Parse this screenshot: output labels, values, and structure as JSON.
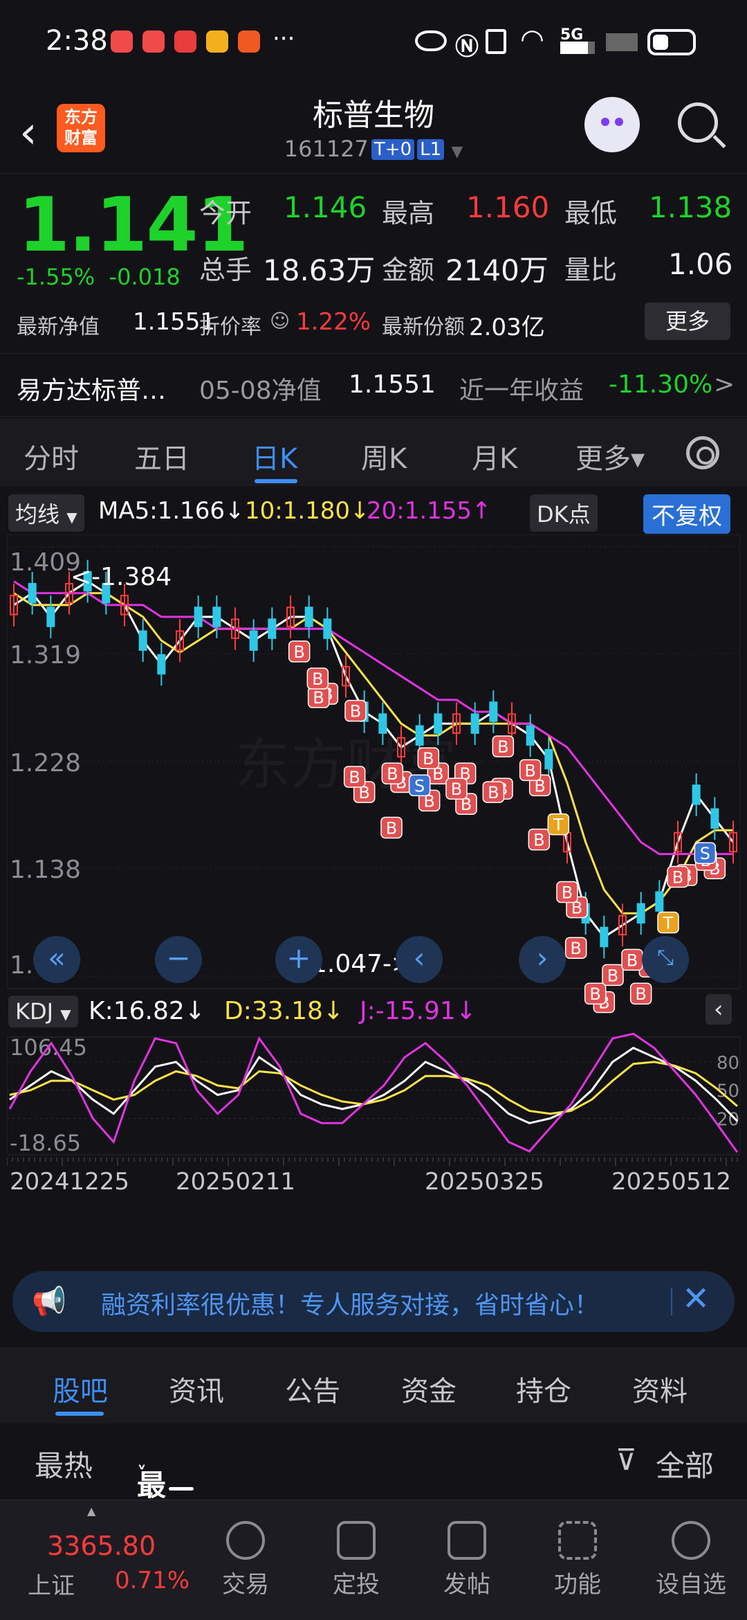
{
  "status_bar": {
    "time": "2:38",
    "more": "···",
    "network": "5G"
  },
  "header": {
    "title": "标普生物",
    "code": "161127",
    "tag1": "T+0",
    "tag2": "L1",
    "logo_line1": "东方",
    "logo_line2": "财富"
  },
  "quote": {
    "price": "1.141",
    "change_pct": "-1.55%",
    "change_abs": "-0.018",
    "open_label": "今开",
    "open": "1.146",
    "high_label": "最高",
    "high": "1.160",
    "low_label": "最低",
    "low": "1.138",
    "volume_label": "总手",
    "volume": "18.63万",
    "amount_label": "金额",
    "amount": "2140万",
    "ratio_label": "量比",
    "ratio": "1.06",
    "nav_label": "最新净值",
    "nav": "1.1551",
    "discount_label": "折价率",
    "discount": "1.22%",
    "shares_label": "最新份额",
    "shares": "2.03亿",
    "more_button": "更多"
  },
  "fund_row": {
    "name": "易方达标普…",
    "nav_date_label": "05-08净值",
    "nav_value": "1.1551",
    "year_return_label": "近一年收益",
    "year_return": "-11.30%",
    "arrow": ">"
  },
  "period_tabs": [
    "分时",
    "五日",
    "日K",
    "周K",
    "月K",
    "更多▾"
  ],
  "chart_header": {
    "indicator": "均线",
    "ma5": "MA5:1.166↓",
    "ma10": "10:1.180↓",
    "ma20": "20:1.155↑",
    "dk_button": "DK点",
    "adjust_button": "不复权"
  },
  "kdj_header": {
    "indicator": "KDJ",
    "k": "K:16.82↓",
    "d": "D:33.18↓",
    "j": "J:-15.91↓"
  },
  "chart_data": [
    {
      "type": "line",
      "title": "",
      "y_ticks": [
        "1.409",
        "1.319",
        "1.228",
        "1.138",
        "1.047"
      ],
      "ylim": [
        1.047,
        1.409
      ],
      "annotations": [
        "<-1.384",
        "1.047->"
      ],
      "series": [
        {
          "name": "MA5",
          "color": "#ffffff",
          "values": [
            1.36,
            1.37,
            1.35,
            1.37,
            1.38,
            1.37,
            1.36,
            1.33,
            1.31,
            1.33,
            1.35,
            1.35,
            1.34,
            1.33,
            1.34,
            1.35,
            1.35,
            1.34,
            1.3,
            1.27,
            1.26,
            1.24,
            1.25,
            1.26,
            1.26,
            1.26,
            1.27,
            1.26,
            1.25,
            1.23,
            1.16,
            1.1,
            1.08,
            1.09,
            1.1,
            1.11,
            1.16,
            1.2,
            1.18,
            1.16
          ]
        },
        {
          "name": "10",
          "color": "#ffe24a",
          "values": [
            1.37,
            1.36,
            1.36,
            1.36,
            1.37,
            1.37,
            1.36,
            1.35,
            1.33,
            1.32,
            1.33,
            1.34,
            1.34,
            1.34,
            1.34,
            1.34,
            1.35,
            1.34,
            1.32,
            1.3,
            1.28,
            1.26,
            1.25,
            1.25,
            1.26,
            1.26,
            1.26,
            1.26,
            1.26,
            1.25,
            1.21,
            1.16,
            1.12,
            1.1,
            1.1,
            1.11,
            1.13,
            1.16,
            1.17,
            1.17
          ]
        },
        {
          "name": "20",
          "color": "#e233e2",
          "values": [
            1.38,
            1.37,
            1.37,
            1.37,
            1.37,
            1.36,
            1.36,
            1.36,
            1.35,
            1.35,
            1.35,
            1.34,
            1.34,
            1.34,
            1.34,
            1.34,
            1.34,
            1.34,
            1.33,
            1.32,
            1.31,
            1.3,
            1.29,
            1.28,
            1.28,
            1.27,
            1.27,
            1.26,
            1.26,
            1.25,
            1.24,
            1.22,
            1.2,
            1.18,
            1.16,
            1.15,
            1.15,
            1.15,
            1.15,
            1.15
          ]
        }
      ],
      "markers_B": 36,
      "markers_S": 2,
      "markers_T": 2
    },
    {
      "type": "line",
      "title": "",
      "y_ticks": [
        "106.45",
        "-18.65"
      ],
      "right_ticks": [
        "80",
        "50",
        "20"
      ],
      "x_ticks": [
        "20241225",
        "20250211",
        "20250325",
        "20250512"
      ],
      "ylim": [
        -18.65,
        106.45
      ],
      "series": [
        {
          "name": "K",
          "color": "#ffffff",
          "values": [
            40,
            55,
            70,
            60,
            40,
            25,
            50,
            75,
            80,
            60,
            45,
            50,
            85,
            70,
            45,
            35,
            30,
            35,
            45,
            60,
            80,
            70,
            60,
            45,
            25,
            15,
            20,
            30,
            50,
            80,
            95,
            85,
            75,
            60,
            40,
            17
          ]
        },
        {
          "name": "D",
          "color": "#ffe24a",
          "values": [
            45,
            50,
            60,
            60,
            50,
            40,
            45,
            60,
            70,
            65,
            55,
            52,
            70,
            68,
            55,
            45,
            38,
            35,
            40,
            50,
            65,
            65,
            62,
            55,
            40,
            28,
            25,
            28,
            40,
            60,
            78,
            80,
            76,
            68,
            52,
            33
          ]
        },
        {
          "name": "J",
          "color": "#e233e2",
          "values": [
            30,
            70,
            100,
            65,
            20,
            -5,
            60,
            105,
            100,
            50,
            25,
            45,
            105,
            75,
            25,
            15,
            15,
            35,
            55,
            85,
            100,
            80,
            55,
            25,
            -5,
            -15,
            10,
            35,
            70,
            105,
            110,
            95,
            70,
            45,
            15,
            -16
          ]
        }
      ]
    }
  ],
  "ad_banner": {
    "text": "融资利率很优惠！专人服务对接，省时省心！",
    "close": "✕"
  },
  "content_tabs": [
    "股吧",
    "资讯",
    "公告",
    "资金",
    "持仓",
    "资料"
  ],
  "sort_bar": {
    "hot": "最热",
    "latest": "最新",
    "filter": "全部"
  },
  "bottom_nav": {
    "index_value": "3365.80",
    "index_name": "上证",
    "index_change": "0.71%",
    "items": [
      "交易",
      "定投",
      "发帖",
      "功能",
      "设自选"
    ]
  },
  "colors": {
    "up": "#ff3b3b",
    "down": "#1fd12b",
    "accent": "#3e8ef7",
    "ma5": "#ffffff",
    "ma10": "#ffe24a",
    "ma20": "#e233e2"
  }
}
